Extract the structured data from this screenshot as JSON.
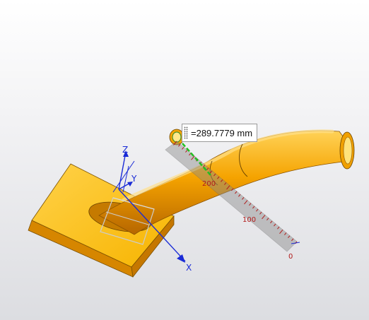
{
  "measurement": {
    "value": "=289.7779 mm"
  },
  "ruler": {
    "ticks": [
      "200",
      "100",
      "0"
    ]
  },
  "triad": {
    "x_label": "X",
    "y_label": "Y",
    "z_label": "Z"
  },
  "colors": {
    "part": "#f2a400",
    "part_light": "#ffcc33",
    "part_dark": "#b86b00",
    "ruler_ticks": "#b21a1a",
    "axis": "#1a2bd6",
    "measure_line": "#22c022"
  }
}
